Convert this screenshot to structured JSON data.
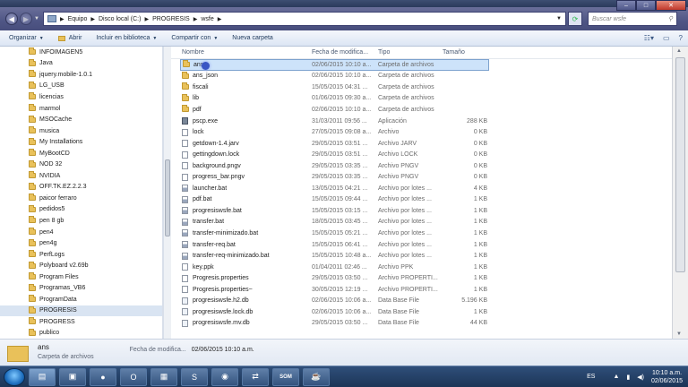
{
  "address": {
    "crumbs": [
      "Equipo",
      "Disco local (C:)",
      "PROGRESIS",
      "wsfe"
    ],
    "search_placeholder": "Buscar wsfe"
  },
  "toolbar": {
    "organize": "Organizar",
    "open": "Abrir",
    "include": "Incluir en biblioteca",
    "share": "Compartir con",
    "new_folder": "Nueva carpeta"
  },
  "sidebar": {
    "items": [
      "INFOIMAGEN5",
      "Java",
      "jquery.mobile-1.0.1",
      "LG_USB",
      "licencias",
      "marmol",
      "MSOCache",
      "musica",
      "My Installations",
      "MyBootCD",
      "NOD 32",
      "NVIDIA",
      "OFF.TK.EZ.2.2.3",
      "paicor ferraro",
      "pedidos5",
      "pen 8 gb",
      "pen4",
      "pen4g",
      "PerfLogs",
      "Polyboard v2.69b",
      "Program Files",
      "Programas_VB6",
      "ProgramData",
      "PROGRESIS",
      "PROGRESS",
      "publico"
    ],
    "selected_index": 23
  },
  "columns": {
    "name": "Nombre",
    "date": "Fecha de modifica...",
    "type": "Tipo",
    "size": "Tamaño"
  },
  "files": [
    {
      "name": "ans",
      "date": "02/06/2015 10:10 a...",
      "type": "Carpeta de archivos",
      "size": "",
      "icon": "folder"
    },
    {
      "name": "ans_json",
      "date": "02/06/2015 10:10 a...",
      "type": "Carpeta de archivos",
      "size": "",
      "icon": "folder"
    },
    {
      "name": "fiscali",
      "date": "15/05/2015 04:31 ...",
      "type": "Carpeta de archivos",
      "size": "",
      "icon": "folder"
    },
    {
      "name": "lib",
      "date": "01/06/2015 09:30 a...",
      "type": "Carpeta de archivos",
      "size": "",
      "icon": "folder"
    },
    {
      "name": "pdf",
      "date": "02/06/2015 10:10 a...",
      "type": "Carpeta de archivos",
      "size": "",
      "icon": "folder"
    },
    {
      "name": "pscp.exe",
      "date": "31/03/2011 09:56 ...",
      "type": "Aplicación",
      "size": "288 KB",
      "icon": "exe"
    },
    {
      "name": "lock",
      "date": "27/05/2015 09:08 a...",
      "type": "Archivo",
      "size": "0 KB",
      "icon": "file"
    },
    {
      "name": "getdown-1.4.jarv",
      "date": "29/05/2015 03:51 ...",
      "type": "Archivo JARV",
      "size": "0 KB",
      "icon": "file"
    },
    {
      "name": "gettingdown.lock",
      "date": "29/05/2015 03:51 ...",
      "type": "Archivo LOCK",
      "size": "0 KB",
      "icon": "file"
    },
    {
      "name": "background.pngv",
      "date": "29/05/2015 03:35 ...",
      "type": "Archivo PNGV",
      "size": "0 KB",
      "icon": "file"
    },
    {
      "name": "progress_bar.pngv",
      "date": "29/05/2015 03:35 ...",
      "type": "Archivo PNGV",
      "size": "0 KB",
      "icon": "file"
    },
    {
      "name": "launcher.bat",
      "date": "13/05/2015 04:21 ...",
      "type": "Archivo por lotes ...",
      "size": "4 KB",
      "icon": "bat"
    },
    {
      "name": "pdf.bat",
      "date": "15/05/2015 09:44 ...",
      "type": "Archivo por lotes ...",
      "size": "1 KB",
      "icon": "bat"
    },
    {
      "name": "progresiswsfe.bat",
      "date": "15/05/2015 03:15 ...",
      "type": "Archivo por lotes ...",
      "size": "1 KB",
      "icon": "bat"
    },
    {
      "name": "transfer.bat",
      "date": "18/05/2015 03:45 ...",
      "type": "Archivo por lotes ...",
      "size": "1 KB",
      "icon": "bat"
    },
    {
      "name": "transfer-minimizado.bat",
      "date": "15/05/2015 05:21 ...",
      "type": "Archivo por lotes ...",
      "size": "1 KB",
      "icon": "bat"
    },
    {
      "name": "transfer-req.bat",
      "date": "15/05/2015 06:41 ...",
      "type": "Archivo por lotes ...",
      "size": "1 KB",
      "icon": "bat"
    },
    {
      "name": "transfer-req-minimizado.bat",
      "date": "15/05/2015 10:48 a...",
      "type": "Archivo por lotes ...",
      "size": "1 KB",
      "icon": "bat"
    },
    {
      "name": "key.ppk",
      "date": "01/04/2011 02:46 ...",
      "type": "Archivo PPK",
      "size": "1 KB",
      "icon": "file"
    },
    {
      "name": "Progresis.properties",
      "date": "29/05/2015 03:50 ...",
      "type": "Archivo PROPERTI...",
      "size": "1 KB",
      "icon": "file"
    },
    {
      "name": "Progresis.properties~",
      "date": "30/05/2015 12:19 ...",
      "type": "Archivo PROPERTI...",
      "size": "1 KB",
      "icon": "file"
    },
    {
      "name": "progresiswsfe.h2.db",
      "date": "02/06/2015 10:06 a...",
      "type": "Data Base File",
      "size": "5.196 KB",
      "icon": "db"
    },
    {
      "name": "progresiswsfe.lock.db",
      "date": "02/06/2015 10:06 a...",
      "type": "Data Base File",
      "size": "1 KB",
      "icon": "db"
    },
    {
      "name": "progresiswsfe.mv.db",
      "date": "29/05/2015 03:50 ...",
      "type": "Data Base File",
      "size": "44 KB",
      "icon": "db"
    }
  ],
  "details": {
    "name": "ans",
    "type": "Carpeta de archivos",
    "modified_label": "Fecha de modifica...",
    "modified_value": "02/06/2015 10:10 a.m."
  },
  "taskbar": {
    "lang": "ES",
    "time": "10:10 a.m.",
    "date": "02/06/2015",
    "apps": [
      "explorer-icon",
      "cmd-icon",
      "firefox-icon",
      "opera-icon",
      "apps-icon",
      "skype-icon",
      "chrome-icon",
      "teamviewer-icon",
      "som-icon",
      "java-icon"
    ],
    "som_label": "SOM"
  }
}
